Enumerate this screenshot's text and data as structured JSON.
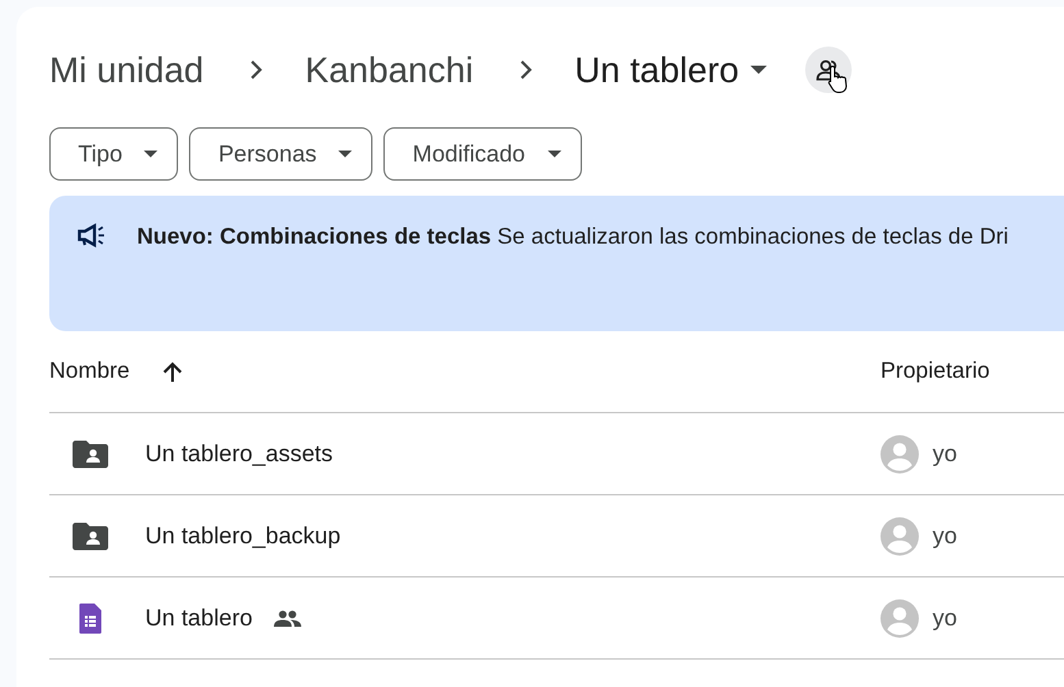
{
  "breadcrumb": [
    {
      "label": "Mi unidad",
      "current": false
    },
    {
      "label": "Kanbanchi",
      "current": false
    },
    {
      "label": "Un tablero",
      "current": true
    }
  ],
  "filters": [
    {
      "label": "Tipo"
    },
    {
      "label": "Personas"
    },
    {
      "label": "Modificado"
    }
  ],
  "banner": {
    "title": "Nuevo: Combinaciones de teclas",
    "text": "Se actualizaron las combinaciones de teclas de Dri"
  },
  "table": {
    "columns": [
      {
        "label": "Nombre",
        "sort_ascending": true
      },
      {
        "label": "Propietario"
      }
    ],
    "rows": [
      {
        "kind": "folder",
        "name": "Un tablero_assets",
        "shared": false,
        "owner": "yo"
      },
      {
        "kind": "folder",
        "name": "Un tablero_backup",
        "shared": false,
        "owner": "yo"
      },
      {
        "kind": "form",
        "name": "Un tablero",
        "shared": true,
        "owner": "yo"
      }
    ]
  }
}
